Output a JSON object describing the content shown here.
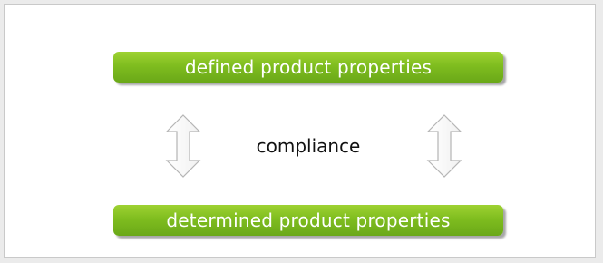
{
  "diagram": {
    "top_box": {
      "label": "defined product properties"
    },
    "relation": {
      "label": "compliance"
    },
    "bottom_box": {
      "label": "determined product properties"
    }
  },
  "colors": {
    "box_fill": "#7fbd1f",
    "arrow_outline": "#b5b5b5",
    "text_dark": "#111111"
  },
  "icons": {
    "left_arrow": "double-headed-vertical-arrow-icon",
    "right_arrow": "double-headed-vertical-arrow-icon"
  }
}
